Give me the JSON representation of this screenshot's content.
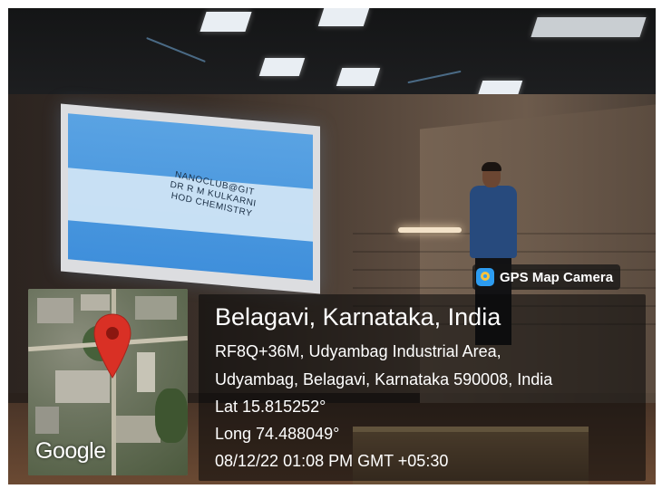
{
  "photo": {
    "screen_text": [
      "NANOCLUB@GIT",
      "DR R M KULKARNI",
      "HOD CHEMISTRY"
    ]
  },
  "overlay": {
    "badge_label": "GPS Map Camera",
    "map_provider": "Google",
    "location_title": "Belagavi, Karnataka, India",
    "address_line1": "RF8Q+36M, Udyambag Industrial Area,",
    "address_line2": "Udyambag, Belagavi, Karnataka 590008, India",
    "latitude": "Lat 15.815252°",
    "longitude": "Long 74.488049°",
    "datetime": "08/12/22 01:08 PM GMT +05:30"
  },
  "colors": {
    "pin": "#d93025",
    "screen_blue": "#4a98df",
    "overlay_bg": "rgba(10,10,10,0.58)"
  },
  "icons": {
    "badge_icon": "gps-map-camera-app-icon",
    "map_pin": "location-pin-icon"
  }
}
